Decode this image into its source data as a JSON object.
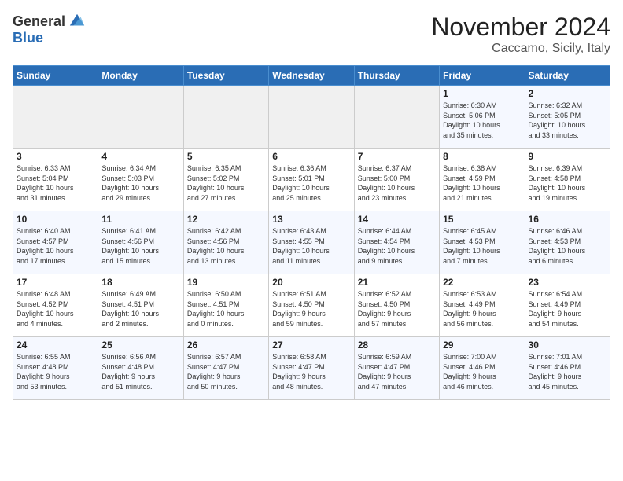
{
  "logo": {
    "general": "General",
    "blue": "Blue"
  },
  "header": {
    "month": "November 2024",
    "location": "Caccamo, Sicily, Italy"
  },
  "days_of_week": [
    "Sunday",
    "Monday",
    "Tuesday",
    "Wednesday",
    "Thursday",
    "Friday",
    "Saturday"
  ],
  "weeks": [
    [
      {
        "day": "",
        "info": ""
      },
      {
        "day": "",
        "info": ""
      },
      {
        "day": "",
        "info": ""
      },
      {
        "day": "",
        "info": ""
      },
      {
        "day": "",
        "info": ""
      },
      {
        "day": "1",
        "info": "Sunrise: 6:30 AM\nSunset: 5:06 PM\nDaylight: 10 hours\nand 35 minutes."
      },
      {
        "day": "2",
        "info": "Sunrise: 6:32 AM\nSunset: 5:05 PM\nDaylight: 10 hours\nand 33 minutes."
      }
    ],
    [
      {
        "day": "3",
        "info": "Sunrise: 6:33 AM\nSunset: 5:04 PM\nDaylight: 10 hours\nand 31 minutes."
      },
      {
        "day": "4",
        "info": "Sunrise: 6:34 AM\nSunset: 5:03 PM\nDaylight: 10 hours\nand 29 minutes."
      },
      {
        "day": "5",
        "info": "Sunrise: 6:35 AM\nSunset: 5:02 PM\nDaylight: 10 hours\nand 27 minutes."
      },
      {
        "day": "6",
        "info": "Sunrise: 6:36 AM\nSunset: 5:01 PM\nDaylight: 10 hours\nand 25 minutes."
      },
      {
        "day": "7",
        "info": "Sunrise: 6:37 AM\nSunset: 5:00 PM\nDaylight: 10 hours\nand 23 minutes."
      },
      {
        "day": "8",
        "info": "Sunrise: 6:38 AM\nSunset: 4:59 PM\nDaylight: 10 hours\nand 21 minutes."
      },
      {
        "day": "9",
        "info": "Sunrise: 6:39 AM\nSunset: 4:58 PM\nDaylight: 10 hours\nand 19 minutes."
      }
    ],
    [
      {
        "day": "10",
        "info": "Sunrise: 6:40 AM\nSunset: 4:57 PM\nDaylight: 10 hours\nand 17 minutes."
      },
      {
        "day": "11",
        "info": "Sunrise: 6:41 AM\nSunset: 4:56 PM\nDaylight: 10 hours\nand 15 minutes."
      },
      {
        "day": "12",
        "info": "Sunrise: 6:42 AM\nSunset: 4:56 PM\nDaylight: 10 hours\nand 13 minutes."
      },
      {
        "day": "13",
        "info": "Sunrise: 6:43 AM\nSunset: 4:55 PM\nDaylight: 10 hours\nand 11 minutes."
      },
      {
        "day": "14",
        "info": "Sunrise: 6:44 AM\nSunset: 4:54 PM\nDaylight: 10 hours\nand 9 minutes."
      },
      {
        "day": "15",
        "info": "Sunrise: 6:45 AM\nSunset: 4:53 PM\nDaylight: 10 hours\nand 7 minutes."
      },
      {
        "day": "16",
        "info": "Sunrise: 6:46 AM\nSunset: 4:53 PM\nDaylight: 10 hours\nand 6 minutes."
      }
    ],
    [
      {
        "day": "17",
        "info": "Sunrise: 6:48 AM\nSunset: 4:52 PM\nDaylight: 10 hours\nand 4 minutes."
      },
      {
        "day": "18",
        "info": "Sunrise: 6:49 AM\nSunset: 4:51 PM\nDaylight: 10 hours\nand 2 minutes."
      },
      {
        "day": "19",
        "info": "Sunrise: 6:50 AM\nSunset: 4:51 PM\nDaylight: 10 hours\nand 0 minutes."
      },
      {
        "day": "20",
        "info": "Sunrise: 6:51 AM\nSunset: 4:50 PM\nDaylight: 9 hours\nand 59 minutes."
      },
      {
        "day": "21",
        "info": "Sunrise: 6:52 AM\nSunset: 4:50 PM\nDaylight: 9 hours\nand 57 minutes."
      },
      {
        "day": "22",
        "info": "Sunrise: 6:53 AM\nSunset: 4:49 PM\nDaylight: 9 hours\nand 56 minutes."
      },
      {
        "day": "23",
        "info": "Sunrise: 6:54 AM\nSunset: 4:49 PM\nDaylight: 9 hours\nand 54 minutes."
      }
    ],
    [
      {
        "day": "24",
        "info": "Sunrise: 6:55 AM\nSunset: 4:48 PM\nDaylight: 9 hours\nand 53 minutes."
      },
      {
        "day": "25",
        "info": "Sunrise: 6:56 AM\nSunset: 4:48 PM\nDaylight: 9 hours\nand 51 minutes."
      },
      {
        "day": "26",
        "info": "Sunrise: 6:57 AM\nSunset: 4:47 PM\nDaylight: 9 hours\nand 50 minutes."
      },
      {
        "day": "27",
        "info": "Sunrise: 6:58 AM\nSunset: 4:47 PM\nDaylight: 9 hours\nand 48 minutes."
      },
      {
        "day": "28",
        "info": "Sunrise: 6:59 AM\nSunset: 4:47 PM\nDaylight: 9 hours\nand 47 minutes."
      },
      {
        "day": "29",
        "info": "Sunrise: 7:00 AM\nSunset: 4:46 PM\nDaylight: 9 hours\nand 46 minutes."
      },
      {
        "day": "30",
        "info": "Sunrise: 7:01 AM\nSunset: 4:46 PM\nDaylight: 9 hours\nand 45 minutes."
      }
    ]
  ]
}
